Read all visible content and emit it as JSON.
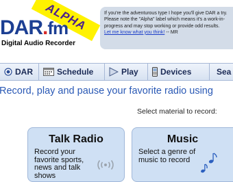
{
  "header": {
    "logo_main": "DAR",
    "logo_dot": ".",
    "logo_fm": "fm",
    "logo_subtitle": "Digital Audio Recorder",
    "alpha_label": "ALPHA",
    "notice": {
      "text": "If you're the adventurous type I hope you'll give DAR a try. Please note the \"Alpha\" label which means it's a work-in-progress and may stop working or provide odd results.",
      "link": "Let me know what you think!",
      "signature": "-- MR"
    }
  },
  "nav": {
    "dar": "DAR",
    "schedule": "Schedule",
    "play": "Play",
    "devices": "Devices",
    "search": "Sea"
  },
  "main": {
    "tagline": "Record, play and pause your favorite radio using",
    "select_label": "Select material to record:"
  },
  "cards": {
    "talk": {
      "title": "Talk Radio",
      "description": "Record your favorite sports, news and talk shows"
    },
    "music": {
      "title": "Music",
      "description": "Select a genre of music to record"
    }
  },
  "colors": {
    "logo_blue": "#1c3f93",
    "logo_red": "#d62a2a",
    "alpha_yellow": "#fff200",
    "alpha_text": "#4a1f8f",
    "notice_bg": "#d3dce8",
    "nav_text": "#1a2a55",
    "tagline_blue": "#2a59b5",
    "card_bg": "#cfe0f4"
  },
  "icons": {
    "dar": "radio-button-icon",
    "schedule": "calendar-icon",
    "play": "play-icon",
    "devices": "phone-icon",
    "talk": "radio-waves-icon",
    "music": "music-notes-icon"
  }
}
